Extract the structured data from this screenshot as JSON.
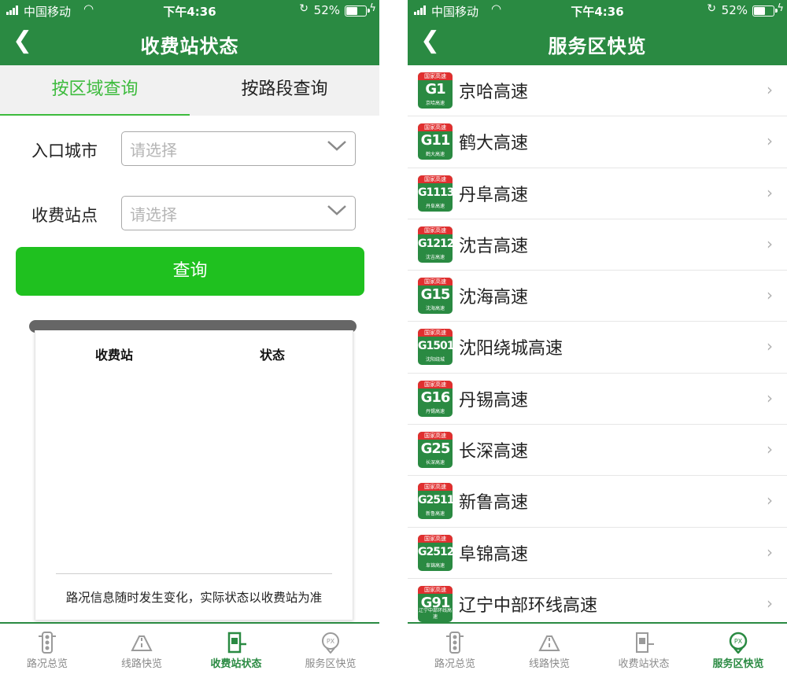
{
  "status_bar": {
    "carrier": "中国移动",
    "time": "下午4:36",
    "battery": "52%"
  },
  "left": {
    "title": "收费站状态",
    "tabs": [
      {
        "label": "按区域查询"
      },
      {
        "label": "按路段查询"
      }
    ],
    "form": {
      "city_label": "入口城市",
      "city_placeholder": "请选择",
      "station_label": "收费站点",
      "station_placeholder": "请选择"
    },
    "query_button": "查询",
    "receipt": {
      "col_station": "收费站",
      "col_status": "状态",
      "note": "路况信息随时发生变化，实际状态以收费站为准"
    }
  },
  "right": {
    "title": "服务区快览",
    "shield_header": "国家高速",
    "highways": [
      {
        "code": "G1",
        "sub": "京哈高速",
        "name": "京哈高速"
      },
      {
        "code": "G11",
        "sub": "鹤大高速",
        "name": "鹤大高速"
      },
      {
        "code": "G1113",
        "sub": "丹阜高速",
        "name": "丹阜高速"
      },
      {
        "code": "G1212",
        "sub": "沈吉高速",
        "name": "沈吉高速"
      },
      {
        "code": "G15",
        "sub": "沈海高速",
        "name": "沈海高速"
      },
      {
        "code": "G1501",
        "sub": "沈阳绕城",
        "name": "沈阳绕城高速"
      },
      {
        "code": "G16",
        "sub": "丹锡高速",
        "name": "丹锡高速"
      },
      {
        "code": "G25",
        "sub": "长深高速",
        "name": "长深高速"
      },
      {
        "code": "G2511",
        "sub": "新鲁高速",
        "name": "新鲁高速"
      },
      {
        "code": "G2512",
        "sub": "阜锦高速",
        "name": "阜锦高速"
      },
      {
        "code": "G91",
        "sub": "辽宁中部环线高速",
        "name": "辽宁中部环线高速"
      }
    ]
  },
  "tabbar": [
    {
      "label": "路况总览",
      "icon": "traffic-light-icon"
    },
    {
      "label": "线路快览",
      "icon": "road-route-icon"
    },
    {
      "label": "收费站状态",
      "icon": "toll-station-icon"
    },
    {
      "label": "服务区快览",
      "icon": "service-area-pin-icon"
    }
  ],
  "colors": {
    "brand": "#2a8a42",
    "accent": "#3dbb3d",
    "button": "#1fc11f",
    "shield_red": "#e02f2f"
  }
}
